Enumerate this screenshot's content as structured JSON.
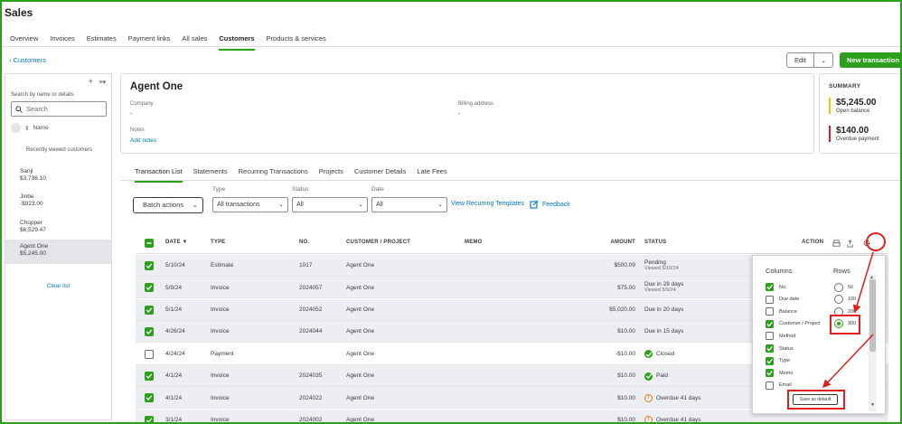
{
  "app": {
    "title": "Sales"
  },
  "nav": {
    "tabs": [
      "Overview",
      "Invoices",
      "Estimates",
      "Payment links",
      "All sales",
      "Customers",
      "Products & services"
    ],
    "active": "Customers"
  },
  "back_link": "Customers",
  "header": {
    "edit_label": "Edit",
    "new_transaction_label": "New transaction"
  },
  "sidebar": {
    "help": "Search by name or details",
    "search_placeholder": "Search",
    "sort_label": "Name",
    "recent_title": "Recently viewed customers",
    "customers": [
      {
        "name": "Sanji",
        "balance": "$3,736.10"
      },
      {
        "name": "Jinbe",
        "balance": "-$923.00"
      },
      {
        "name": "Chopper",
        "balance": "$6,529.47"
      },
      {
        "name": "Agent One",
        "balance": "$5,245.00"
      }
    ],
    "clear_label": "Clear list"
  },
  "customer": {
    "name": "Agent One",
    "company_label": "Company",
    "company_value": "-",
    "billing_label": "Billing address",
    "billing_value": "-",
    "notes_label": "Notes",
    "add_notes": "Add notes"
  },
  "summary": {
    "title": "SUMMARY",
    "open_amount": "$5,245.00",
    "open_label": "Open balance",
    "overdue_amount": "$140.00",
    "overdue_label": "Overdue payment",
    "open_color": "#f5c400",
    "overdue_color": "#e01f1f"
  },
  "txn_tabs": [
    "Transaction List",
    "Statements",
    "Recurring Transactions",
    "Projects",
    "Customer Details",
    "Late Fees"
  ],
  "filters": {
    "batch_label": "Batch actions",
    "type_label": "Type",
    "type_value": "All transactions",
    "status_label": "Status",
    "status_value": "All",
    "date_label": "Date",
    "date_value": "All",
    "recurring_link": "View Recurring Templates",
    "feedback_link": "Feedback"
  },
  "table": {
    "headers": {
      "date": "DATE ▼",
      "type": "TYPE",
      "no": "NO.",
      "customer": "CUSTOMER / PROJECT",
      "memo": "MEMO",
      "amount": "AMOUNT",
      "status": "STATUS",
      "action": "ACTION"
    },
    "rows": [
      {
        "checked": true,
        "date": "5/10/24",
        "type": "Estimate",
        "no": "1017",
        "customer": "Agent One",
        "amount": "$500.09",
        "status": "Pending",
        "status_sub": "Viewed 5/10/24",
        "icon": ""
      },
      {
        "checked": true,
        "date": "5/9/24",
        "type": "Invoice",
        "no": "2024057",
        "customer": "Agent One",
        "amount": "$75.00",
        "status": "Due in 28 days",
        "status_sub": "Viewed 5/9/24",
        "icon": ""
      },
      {
        "checked": true,
        "date": "5/1/24",
        "type": "Invoice",
        "no": "2024052",
        "customer": "Agent One",
        "amount": "$5,020.00",
        "status": "Due in 20 days",
        "status_sub": "",
        "icon": ""
      },
      {
        "checked": true,
        "date": "4/26/24",
        "type": "Invoice",
        "no": "2024044",
        "customer": "Agent One",
        "amount": "$10.00",
        "status": "Due in 15 days",
        "status_sub": "",
        "icon": ""
      },
      {
        "checked": false,
        "date": "4/24/24",
        "type": "Payment",
        "no": "",
        "customer": "Agent One",
        "amount": "-$10.00",
        "status": "Closed",
        "status_sub": "",
        "icon": "check"
      },
      {
        "checked": true,
        "date": "4/1/24",
        "type": "Invoice",
        "no": "2024035",
        "customer": "Agent One",
        "amount": "$10.00",
        "status": "Paid",
        "status_sub": "",
        "icon": "check"
      },
      {
        "checked": true,
        "date": "4/1/24",
        "type": "Invoice",
        "no": "2024022",
        "customer": "Agent One",
        "amount": "$10.00",
        "status": "Overdue 41 days",
        "status_sub": "",
        "icon": "warn"
      },
      {
        "checked": true,
        "date": "3/1/24",
        "type": "Invoice",
        "no": "2024002",
        "customer": "Agent One",
        "amount": "$10.00",
        "status": "Overdue 41 days",
        "status_sub": "",
        "icon": "warn"
      }
    ]
  },
  "settings_panel": {
    "columns_title": "Columns",
    "rows_title": "Rows",
    "columns": [
      {
        "label": "No.",
        "checked": true
      },
      {
        "label": "Due date",
        "checked": false
      },
      {
        "label": "Balance",
        "checked": false
      },
      {
        "label": "Customer / Project",
        "checked": true
      },
      {
        "label": "Method",
        "checked": false
      },
      {
        "label": "Status",
        "checked": true
      },
      {
        "label": "Type",
        "checked": true
      },
      {
        "label": "Memo",
        "checked": true
      },
      {
        "label": "Email",
        "checked": false
      }
    ],
    "row_options": [
      {
        "label": "50",
        "selected": false
      },
      {
        "label": "100",
        "selected": false
      },
      {
        "label": "200",
        "selected": false
      },
      {
        "label": "300",
        "selected": true
      }
    ],
    "save_default_label": "Save as default"
  }
}
